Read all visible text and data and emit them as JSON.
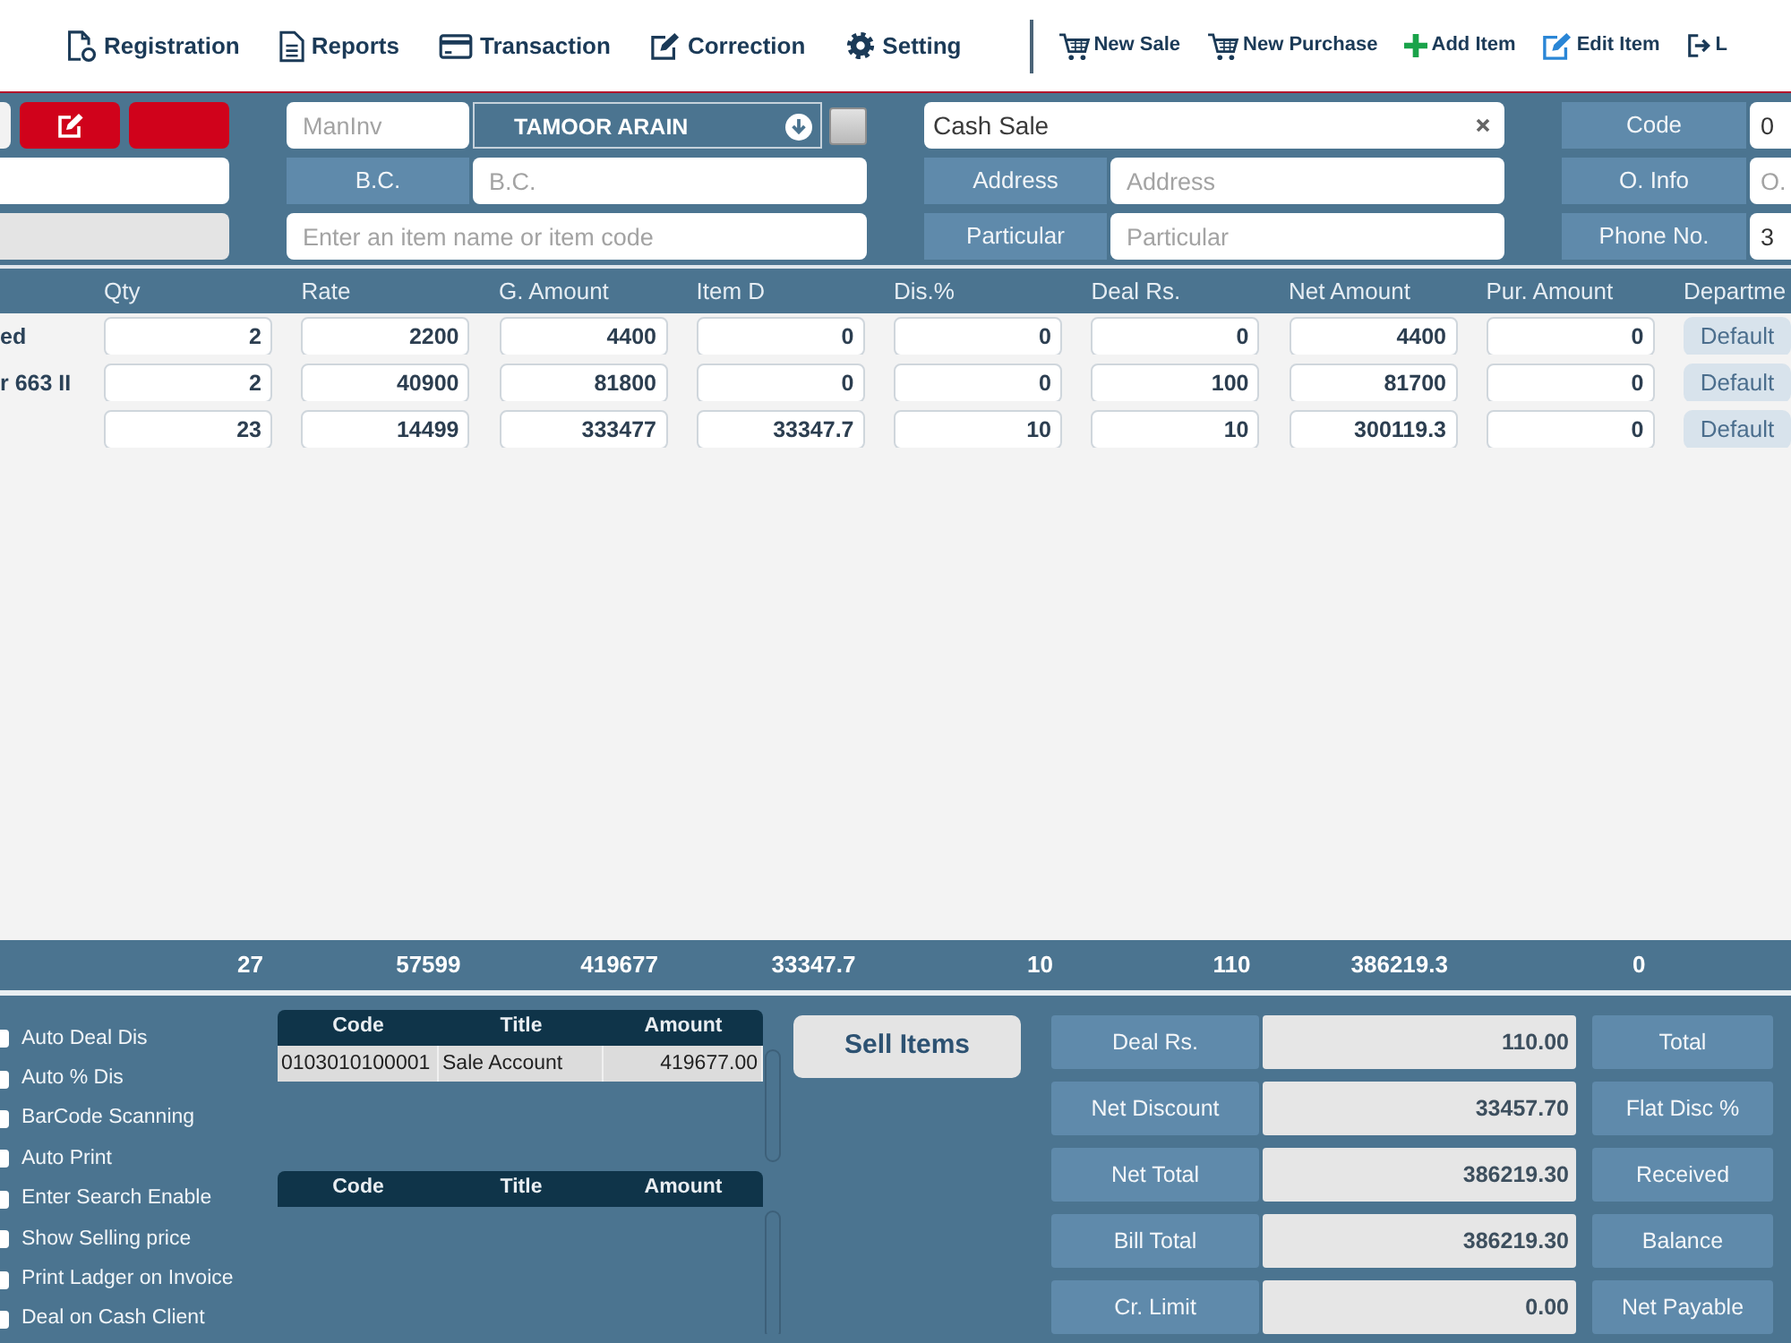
{
  "top_menu": [
    {
      "label": "Registration"
    },
    {
      "label": "Reports"
    },
    {
      "label": "Transaction"
    },
    {
      "label": "Correction"
    },
    {
      "label": "Setting"
    }
  ],
  "quick_actions": [
    {
      "label": "New Sale"
    },
    {
      "label": "New Purchase"
    },
    {
      "label": "Add Item"
    },
    {
      "label": "Edit Item"
    },
    {
      "label": "L"
    }
  ],
  "left_panel": {
    "fields": [
      {
        "disabled": false
      },
      {
        "disabled": true
      }
    ]
  },
  "invoice": {
    "manual_invoice": {
      "placeholder": "ManInv"
    },
    "customer": {
      "value": "TAMOOR ARAIN"
    },
    "customer_checkbox": {
      "checked": false
    },
    "bc": {
      "label": "B.C.",
      "placeholder": "B.C."
    },
    "item_search": {
      "placeholder": "Enter an item name or item code"
    }
  },
  "account": {
    "select": {
      "value": "Cash Sale"
    },
    "address": {
      "label": "Address",
      "placeholder": "Address"
    },
    "particular": {
      "label": "Particular",
      "placeholder": "Particular"
    }
  },
  "contact": [
    {
      "label": "Code",
      "value": "0"
    },
    {
      "label": "O. Info",
      "placeholder": "O."
    },
    {
      "label": "Phone No.",
      "value": "3"
    }
  ],
  "items_table": {
    "columns": [
      "Qty",
      "Rate",
      "G. Amount",
      "Item D",
      "Dis.%",
      "Deal Rs.",
      "Net Amount",
      "Pur. Amount",
      "Departme"
    ],
    "rows": [
      {
        "column_1": "ed",
        "values": [
          "2",
          "2200",
          "4400",
          "0",
          "0",
          "0",
          "4400",
          "0"
        ],
        "department": "Default"
      },
      {
        "column_1": "r 663 II",
        "values": [
          "2",
          "40900",
          "81800",
          "0",
          "0",
          "100",
          "81700",
          "0"
        ],
        "department": "Default"
      },
      {
        "values": [
          "23",
          "14499",
          "333477",
          "33347.7",
          "10",
          "10",
          "300119.3",
          "0"
        ],
        "department": "Default"
      }
    ],
    "totals": [
      "27",
      "57599",
      "419677",
      "33347.7",
      "10",
      "110",
      "386219.3",
      "0"
    ]
  },
  "options": [
    {
      "label": "Auto Deal Dis",
      "checked": false
    },
    {
      "label": "Auto % Dis",
      "checked": false
    },
    {
      "label": "BarCode Scanning",
      "checked": false
    },
    {
      "label": "Auto Print",
      "checked": false
    },
    {
      "label": "Enter Search Enable",
      "checked": false
    },
    {
      "label": "Show Selling price",
      "checked": false
    },
    {
      "label": "Print Ladger on Invoice",
      "checked": false
    },
    {
      "label": "Deal on Cash Client",
      "checked": false
    }
  ],
  "ledgers": [
    {
      "columns": [
        "Code",
        "Title",
        "Amount"
      ],
      "rows": [
        [
          "0103010100001",
          "Sale Account",
          "419677.00"
        ]
      ]
    },
    {
      "columns": [
        "Code",
        "Title",
        "Amount"
      ]
    }
  ],
  "sell_button": {
    "label": "Sell Items"
  },
  "summary": [
    {
      "label": "Deal Rs.",
      "value": "110.00"
    },
    {
      "label": "Net Discount",
      "value": "33457.70"
    },
    {
      "label": "Net Total",
      "value": "386219.30"
    },
    {
      "label": "Bill Total",
      "value": "386219.30"
    },
    {
      "label": "Cr. Limit",
      "value": "0.00"
    }
  ],
  "summary_right": [
    {
      "label": "Total"
    },
    {
      "label": "Flat Disc %"
    },
    {
      "label": "Received"
    },
    {
      "label": "Balance"
    },
    {
      "label": "Net Payable"
    }
  ]
}
